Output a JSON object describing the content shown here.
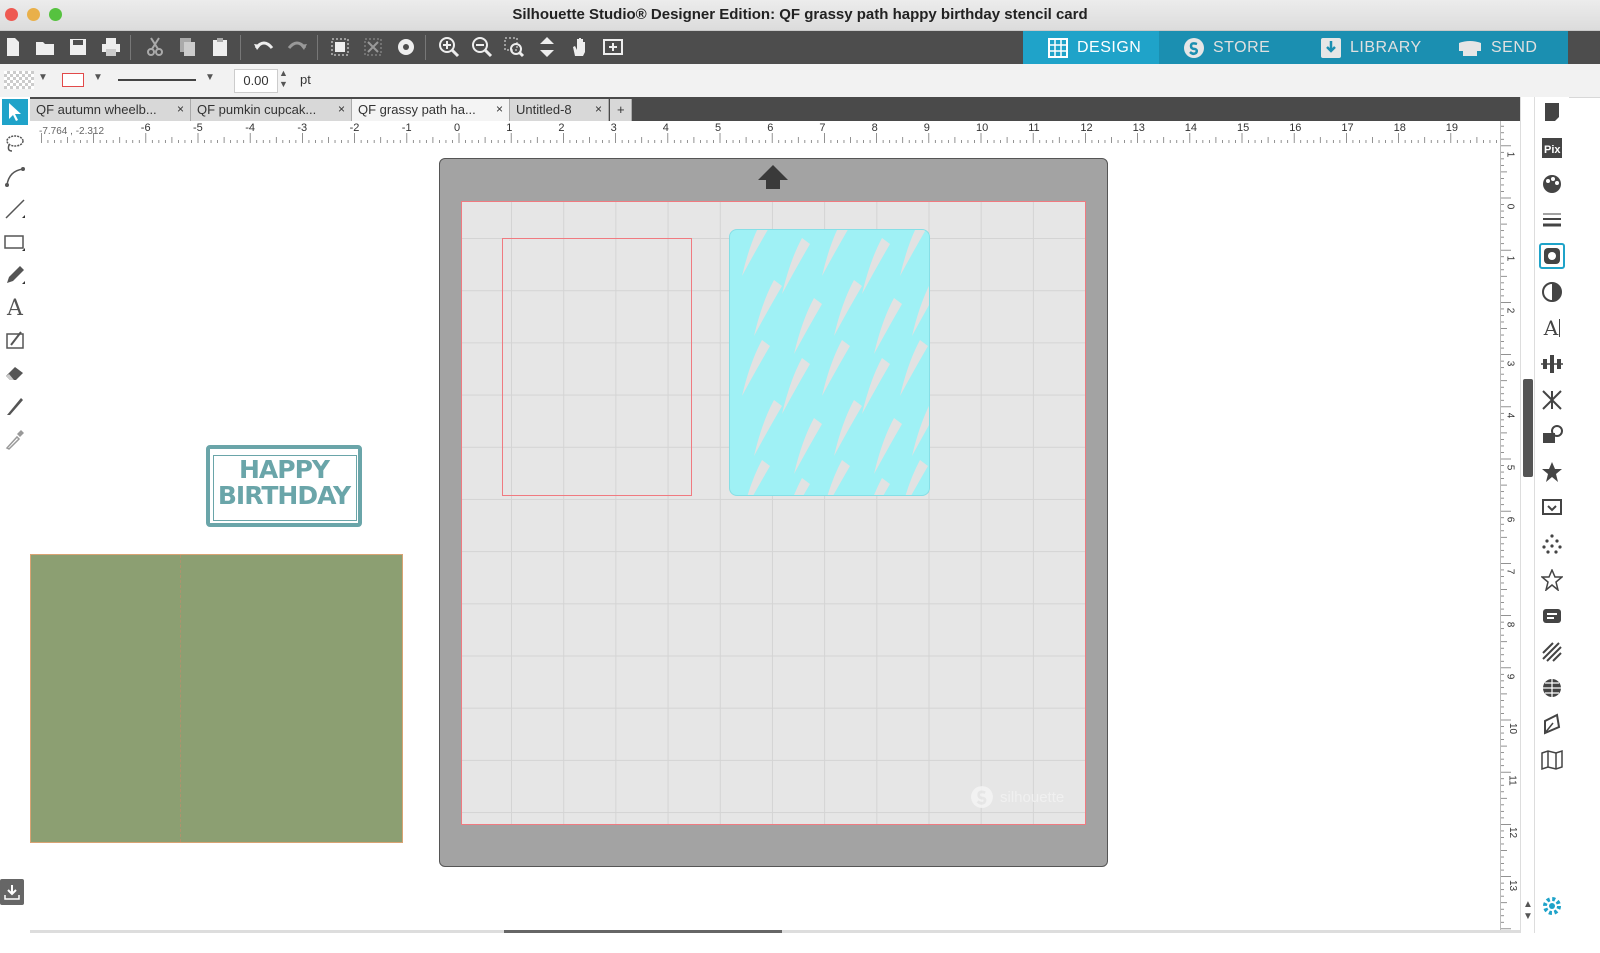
{
  "window": {
    "title": "Silhouette Studio® Designer Edition: QF grassy path happy birthday stencil card"
  },
  "nav_tabs": [
    {
      "label": "DESIGN",
      "icon": "grid-icon",
      "active": true
    },
    {
      "label": "STORE",
      "icon": "silhouette-s-icon",
      "active": false
    },
    {
      "label": "LIBRARY",
      "icon": "library-download-icon",
      "active": false
    },
    {
      "label": "SEND",
      "icon": "cutter-icon",
      "active": false
    }
  ],
  "properties": {
    "line_width_value": "0.00",
    "line_width_unit": "pt"
  },
  "doc_tabs": [
    {
      "label": "QF autumn wheelb...",
      "active": false
    },
    {
      "label": "QF pumkin cupcak...",
      "active": false
    },
    {
      "label": "QF grassy path ha...",
      "active": true
    },
    {
      "label": "Untitled-8",
      "active": false
    }
  ],
  "add_tab_label": "+",
  "close_tab_label": "×",
  "ruler": {
    "coordinates": "-7.764 , -2.312",
    "h_numbers": [
      "-6",
      "-5",
      "-4",
      "-3",
      "-2",
      "-1",
      "0",
      "1",
      "2",
      "3",
      "4",
      "5",
      "6",
      "7",
      "8",
      "9",
      "10",
      "11",
      "12",
      "13",
      "14",
      "15",
      "16",
      "17",
      "18",
      "19"
    ],
    "v_numbers": [
      "1",
      "0",
      "1",
      "2",
      "3",
      "4",
      "5",
      "6",
      "7",
      "8",
      "9",
      "10",
      "11",
      "12",
      "13"
    ]
  },
  "card_text": {
    "line1": "HAPPY",
    "line2": "BIRTHDAY"
  },
  "mat_watermark": "silhouette",
  "colors": {
    "nav_active": "#1fa3c9",
    "toolbar_bg": "#4d4d4d",
    "mat_bg": "#a3a3a3",
    "stencil": "#9ff1f5",
    "card_green": "#8c9f72",
    "label_teal": "#6aa5a9",
    "cut_line": "#f07a80"
  }
}
